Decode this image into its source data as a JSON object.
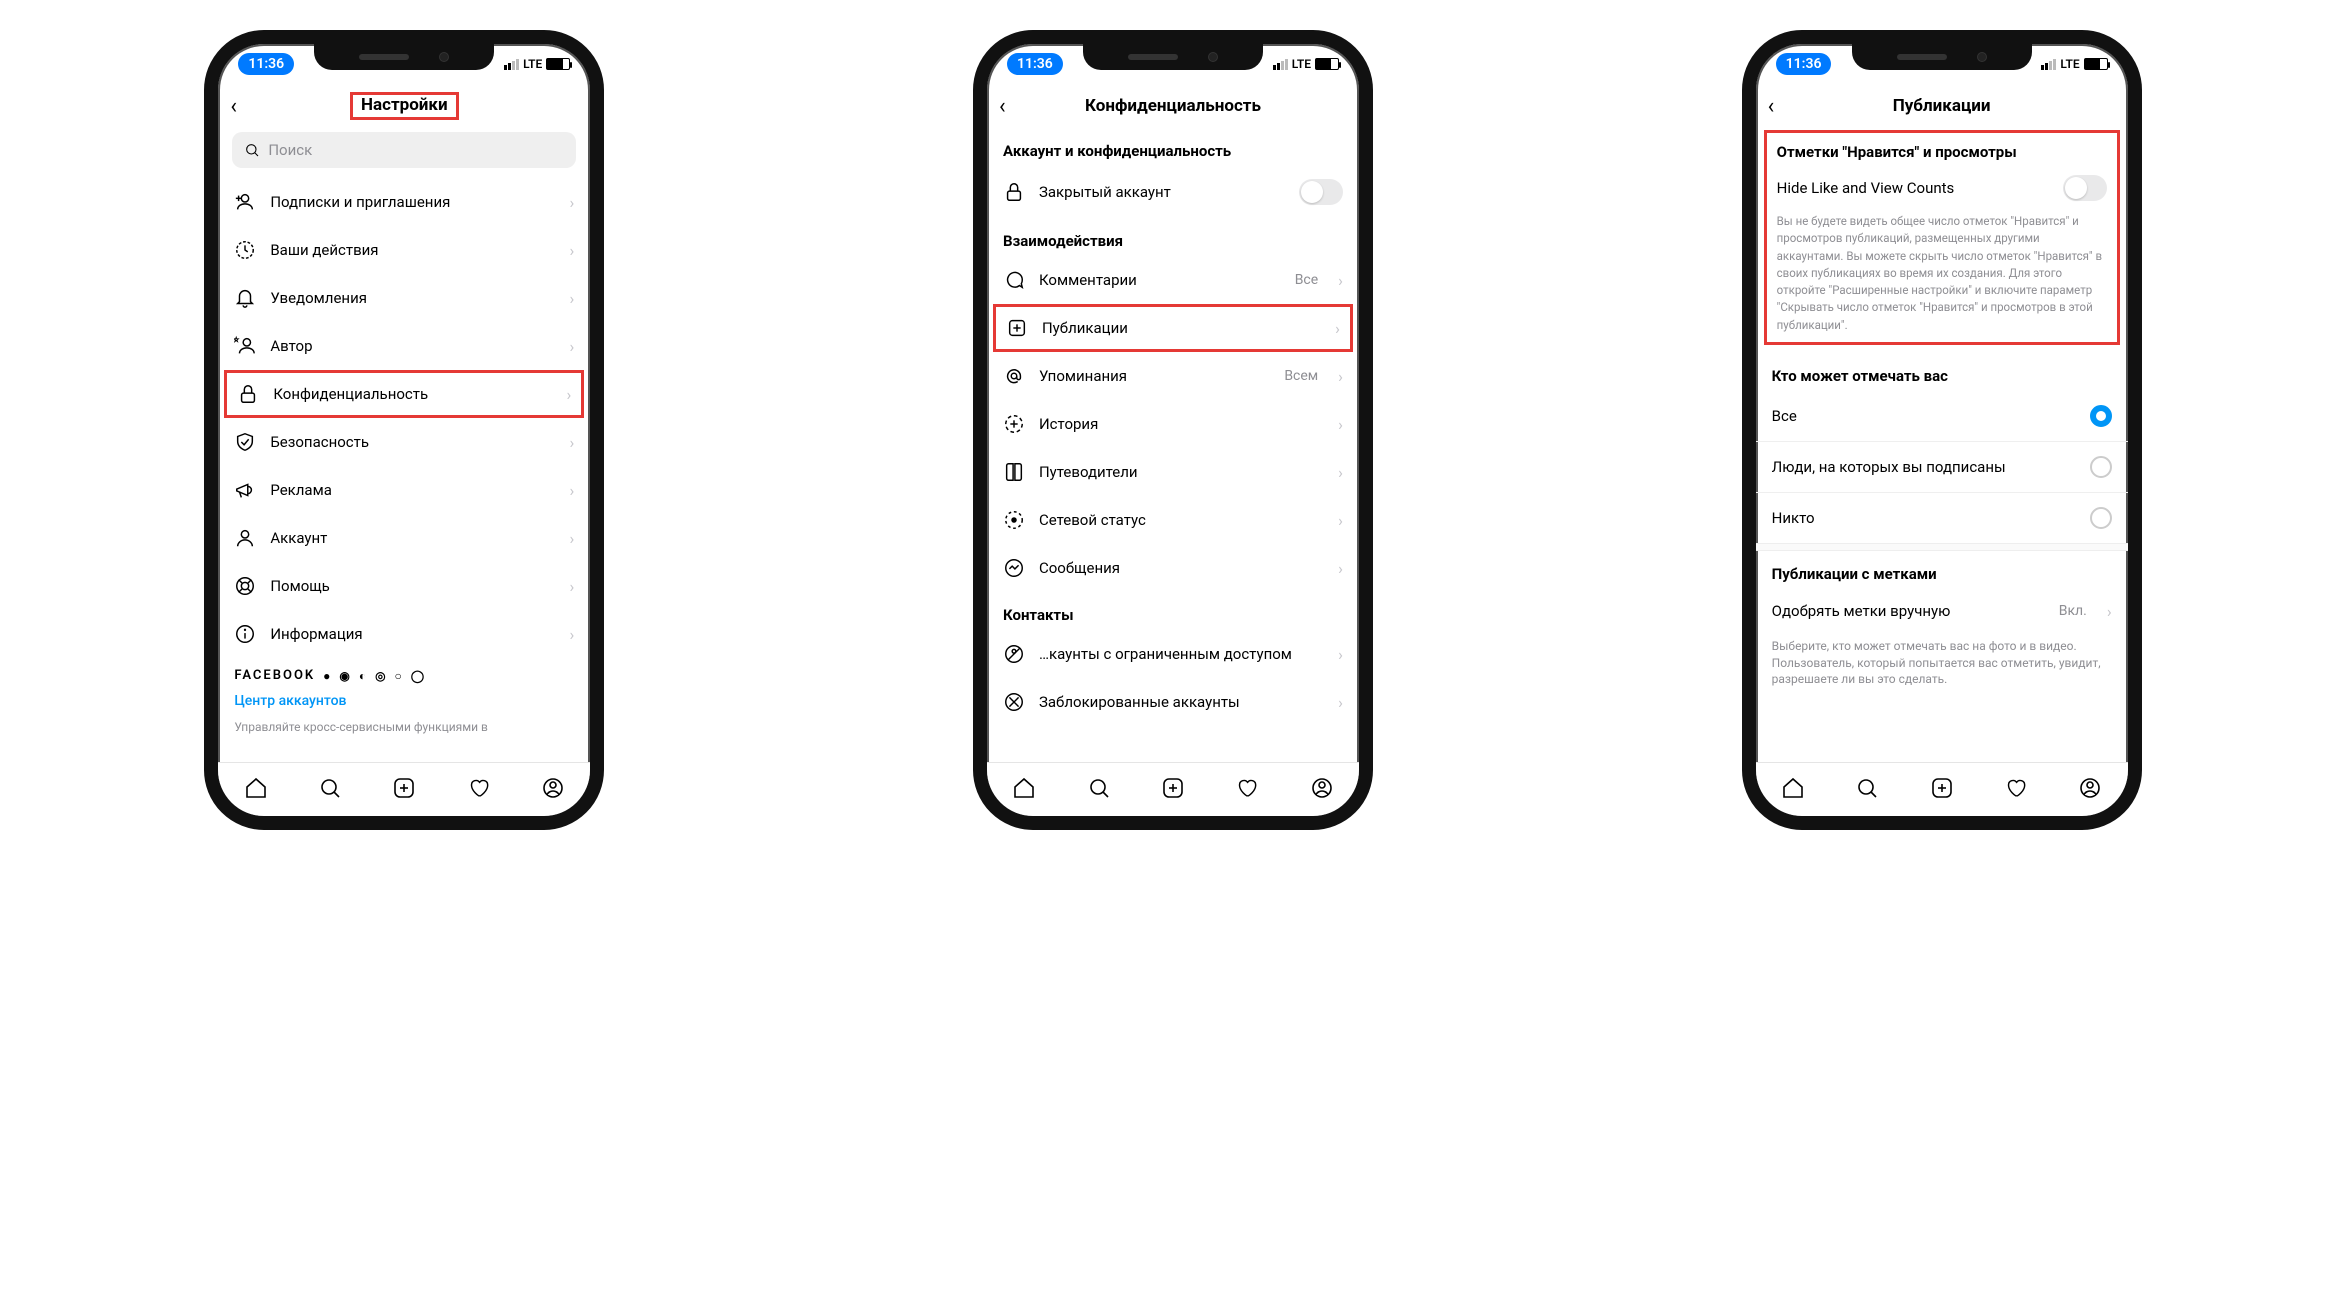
{
  "status": {
    "time": "11:36",
    "network": "LTE"
  },
  "screen1": {
    "title": "Настройки",
    "search_placeholder": "Поиск",
    "items": [
      {
        "label": "Подписки и приглашения"
      },
      {
        "label": "Ваши действия"
      },
      {
        "label": "Уведомления"
      },
      {
        "label": "Автор"
      },
      {
        "label": "Конфиденциальность",
        "highlight": true
      },
      {
        "label": "Безопасность"
      },
      {
        "label": "Реклама"
      },
      {
        "label": "Аккаунт"
      },
      {
        "label": "Помощь"
      },
      {
        "label": "Информация"
      }
    ],
    "fb_label": "FACEBOOK",
    "accounts_center": "Центр аккаунтов",
    "footer": "Управляйте кросс-сервисными функциями в"
  },
  "screen2": {
    "title": "Конфиденциальность",
    "sec_account": "Аккаунт и конфиденциальность",
    "private_account": "Закрытый аккаунт",
    "sec_interactions": "Взаимодействия",
    "items_int": [
      {
        "label": "Комментарии",
        "value": "Все"
      },
      {
        "label": "Публикации",
        "highlight": true
      },
      {
        "label": "Упоминания",
        "value": "Всем"
      },
      {
        "label": "История"
      },
      {
        "label": "Путеводители"
      },
      {
        "label": "Сетевой статус"
      },
      {
        "label": "Сообщения"
      }
    ],
    "sec_contacts": "Контакты",
    "items_contacts": [
      {
        "label": "…каунты с ограниченным доступом"
      },
      {
        "label": "Заблокированные аккаунты"
      }
    ]
  },
  "screen3": {
    "title": "Публикации",
    "sec_likes": "Отметки \"Нравится\" и просмотры",
    "hide_label": "Hide Like and View Counts",
    "hide_desc": "Вы не будете видеть общее число отметок \"Нравится\" и просмотров публикаций, размещенных другими аккаунтами. Вы можете скрыть число отметок \"Нравится\" в своих публикациях во время их создания. Для этого откройте \"Расширенные настройки\" и включите параметр \"Скрывать число отметок \"Нравится\" и просмотров в этой публикации\".",
    "sec_tag": "Кто может отмечать вас",
    "tag_options": [
      {
        "label": "Все",
        "selected": true
      },
      {
        "label": "Люди, на которых вы подписаны"
      },
      {
        "label": "Никто"
      }
    ],
    "sec_tagged": "Публикации с метками",
    "approve_label": "Одобрять метки вручную",
    "approve_value": "Вкл.",
    "approve_desc": "Выберите, кто может отмечать вас на фото и в видео. Пользователь, который попытается вас отметить, увидит, разрешаете ли вы это сделать."
  }
}
